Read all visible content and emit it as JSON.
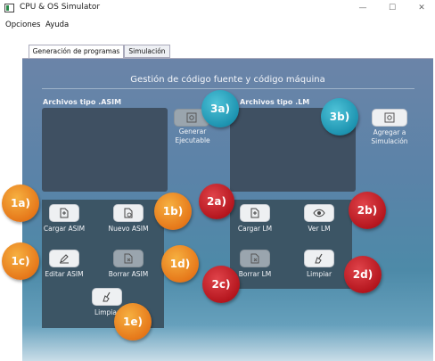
{
  "window": {
    "title": "CPU & OS Simulator",
    "minimize_glyph": "—",
    "maximize_glyph": "☐",
    "close_glyph": "✕"
  },
  "menu": [
    "Opciones",
    "Ayuda"
  ],
  "tabs": [
    {
      "label": "Generación de programas",
      "active": true
    },
    {
      "label": "Simulación",
      "active": false
    }
  ],
  "main": {
    "header": "Gestión de código fuente y código máquina",
    "asim_label": "Archivos tipo .ASIM",
    "lm_label": "Archivos tipo .LM",
    "generate_label_line1": "Generar",
    "generate_label_line2": "Ejecutable",
    "add_sim_line1": "Agregar a",
    "add_sim_line2": "Simulación"
  },
  "asim_buttons": {
    "load": "Cargar ASIM",
    "new": "Nuevo ASIM",
    "edit": "Editar ASIM",
    "delete": "Borrar ASIM",
    "clean": "Limpiar"
  },
  "lm_buttons": {
    "load": "Cargar LM",
    "view": "Ver LM",
    "delete": "Borrar LM",
    "clean": "Limpiar"
  },
  "callouts": {
    "c1a": "1a)",
    "c1b": "1b)",
    "c1c": "1c)",
    "c1d": "1d)",
    "c1e": "1e)",
    "c2a": "2a)",
    "c2b": "2b)",
    "c2c": "2c)",
    "c2d": "2d)",
    "c3a": "3a)",
    "c3b": "3b)"
  },
  "colors": {
    "callout_orange": "#e6781a",
    "callout_red": "#b5161e",
    "callout_teal": "#1d93b0"
  }
}
